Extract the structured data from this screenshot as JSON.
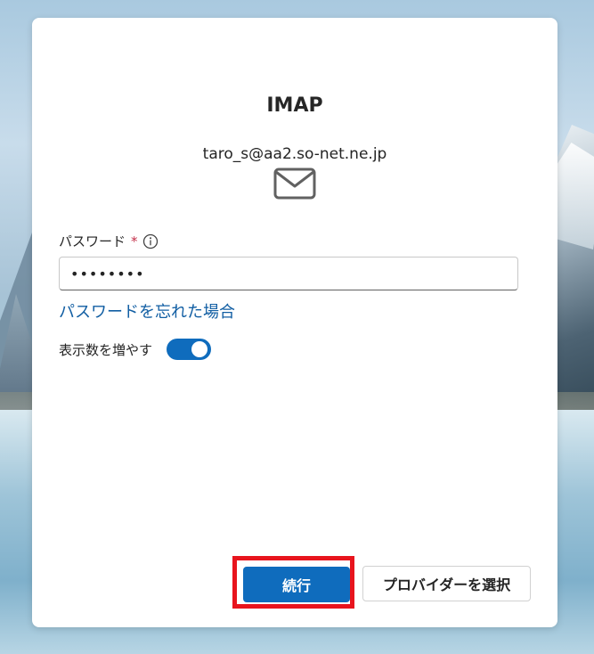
{
  "dialog": {
    "title": "IMAP",
    "email": "taro_s@aa2.so-net.ne.jp",
    "password": {
      "label": "パスワード",
      "required_mark": "*",
      "value": "••••••••"
    },
    "forgot_link": "パスワードを忘れた場合",
    "toggle": {
      "label": "表示数を増やす",
      "on": true
    },
    "buttons": {
      "continue": "続行",
      "select_provider": "プロバイダーを選択"
    }
  },
  "icons": {
    "mail": "mail-icon",
    "info": "info-icon"
  },
  "colors": {
    "accent": "#0f6cbd",
    "link": "#115ea3",
    "required": "#c4314b",
    "highlight": "#e8141d"
  }
}
